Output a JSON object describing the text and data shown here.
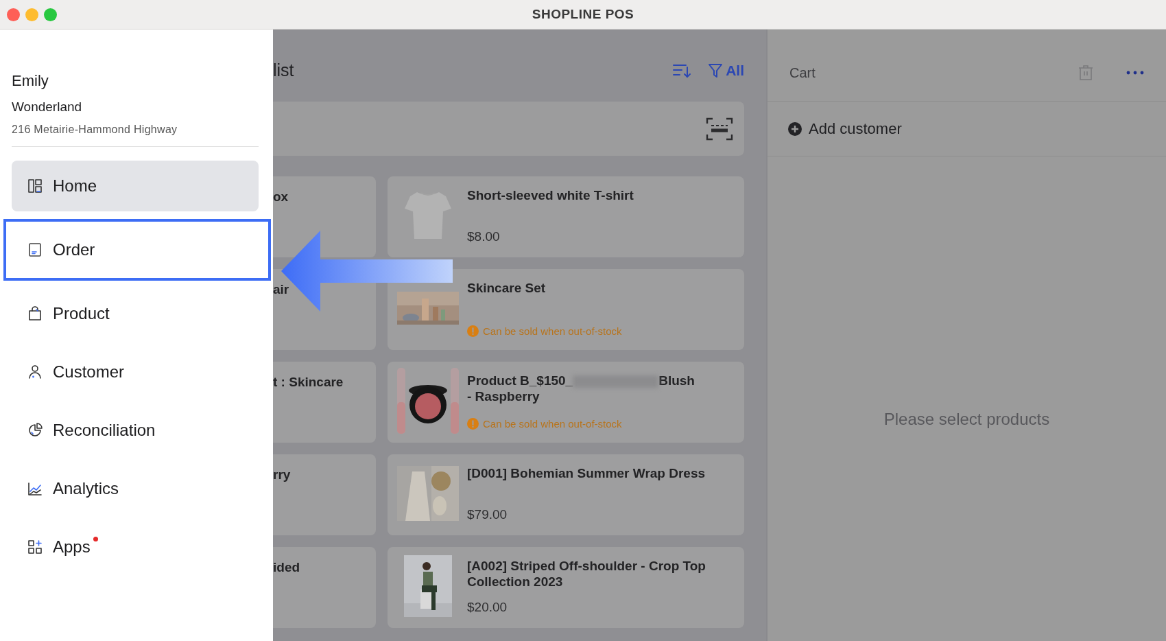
{
  "window": {
    "title": "SHOPLINE POS"
  },
  "sidebar": {
    "user": "Emily",
    "store": "Wonderland",
    "address": "216 Metairie-Hammond Highway",
    "items": [
      {
        "label": "Home",
        "selected": true,
        "highlighted": false,
        "badge": false
      },
      {
        "label": "Order",
        "selected": false,
        "highlighted": true,
        "badge": false
      },
      {
        "label": "Product",
        "selected": false,
        "highlighted": false,
        "badge": false
      },
      {
        "label": "Customer",
        "selected": false,
        "highlighted": false,
        "badge": false
      },
      {
        "label": "Reconciliation",
        "selected": false,
        "highlighted": false,
        "badge": false
      },
      {
        "label": "Analytics",
        "selected": false,
        "highlighted": false,
        "badge": false
      },
      {
        "label": "Apps",
        "selected": false,
        "highlighted": false,
        "badge": true
      }
    ]
  },
  "product_list": {
    "title": "list",
    "filter": "All",
    "left_column": [
      "ox",
      "air",
      "t : Skincare",
      "rry",
      "ided"
    ],
    "products": [
      {
        "name": "Short-sleeved white T-shirt",
        "price": "$8.00"
      },
      {
        "name": "Skincare Set",
        "warning": "Can be sold when out-of-stock"
      },
      {
        "name": "Product B_$150_",
        "redacted": true,
        "name_after": "Blush",
        "name_line2": "- Raspberry",
        "warning": "Can be sold when out-of-stock"
      },
      {
        "name": "[D001] Bohemian Summer Wrap Dress",
        "price": "$79.00"
      },
      {
        "name": "[A002] Striped Off-shoulder - Crop Top Collection 2023",
        "price": "$20.00"
      }
    ]
  },
  "cart": {
    "title": "Cart",
    "add_customer": "Add customer",
    "empty_message": "Please select products"
  }
}
